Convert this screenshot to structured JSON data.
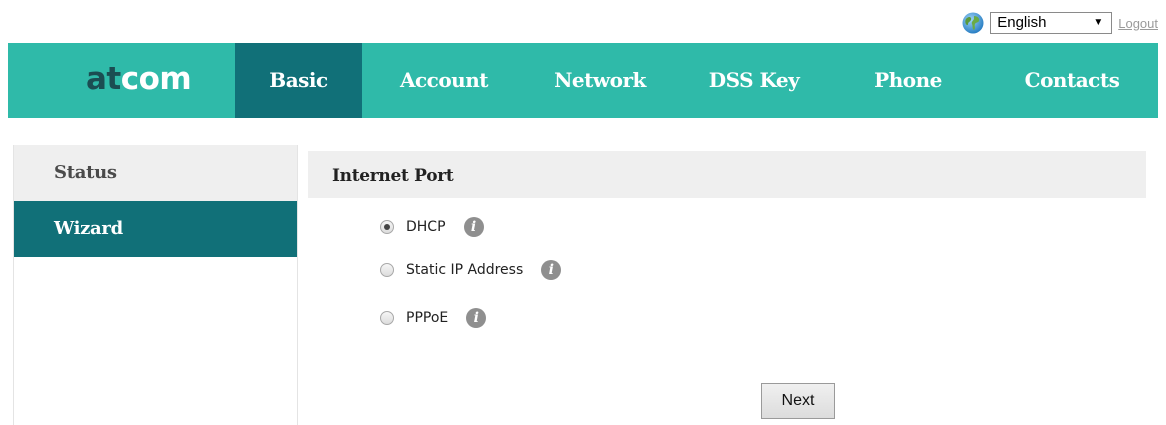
{
  "header": {
    "language": {
      "selected": "English"
    },
    "logout_label": "Logout"
  },
  "brand": {
    "logo_text": "atcom",
    "colors": {
      "nav_bg": "#2fbaa9",
      "active_bg": "#117078",
      "logo_dark": "#1b4d52"
    }
  },
  "nav": {
    "tabs": [
      {
        "label": "Basic",
        "active": true
      },
      {
        "label": "Account",
        "active": false
      },
      {
        "label": "Network",
        "active": false
      },
      {
        "label": "DSS Key",
        "active": false
      },
      {
        "label": "Phone",
        "active": false
      },
      {
        "label": "Contacts",
        "active": false
      }
    ]
  },
  "sidebar": {
    "items": [
      {
        "label": "Status",
        "active": false
      },
      {
        "label": "Wizard",
        "active": true
      }
    ]
  },
  "main": {
    "section_title": "Internet Port",
    "options": [
      {
        "label": "DHCP",
        "checked": true,
        "icon": "info-icon"
      },
      {
        "label": "Static IP Address",
        "checked": false,
        "icon": "info-icon"
      },
      {
        "label": "PPPoE",
        "checked": false,
        "icon": "info-icon"
      }
    ],
    "next_label": "Next"
  }
}
